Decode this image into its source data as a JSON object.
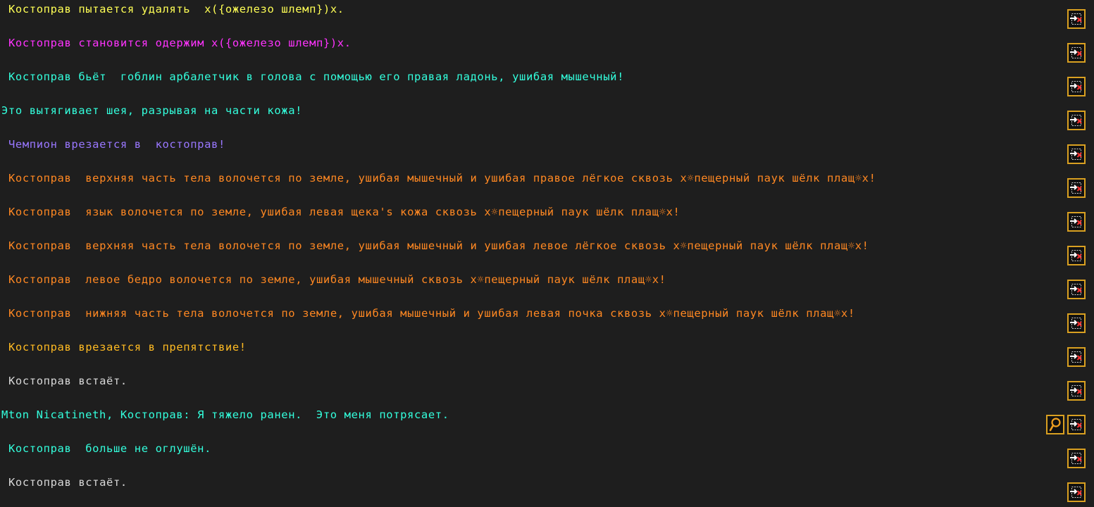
{
  "colors": {
    "yellow": "#ffff55",
    "magenta": "#ff33ff",
    "cyan": "#33ffdd",
    "violet": "#9977ff",
    "orange": "#ff8822",
    "amber": "#ffbb22",
    "white": "#d8d8d8",
    "button_border": "#d9a021"
  },
  "messages": [
    {
      "text": "Костоправ пытается удалять  x({ожелезо шлемп})x.",
      "color": "yellow",
      "indent": true,
      "zoom": false
    },
    {
      "text": "Костоправ становится одержим x({ожелезо шлемп})x.",
      "color": "magenta",
      "indent": true,
      "zoom": false
    },
    {
      "text": "Костоправ бьёт  гоблин арбалетчик в голова с помощью его правая ладонь, ушибая мышечный!",
      "color": "cyan",
      "indent": true,
      "zoom": false
    },
    {
      "text": "Это вытягивает шея, разрывая на части кожа!",
      "color": "cyan",
      "indent": false,
      "zoom": false
    },
    {
      "text": "Чемпион врезается в  костоправ!",
      "color": "violet",
      "indent": true,
      "zoom": false
    },
    {
      "text": "Костоправ  верхняя часть тела волочется по земле, ушибая мышечный и ушибая правое лёгкое сквозь x☼пещерный паук шёлк плащ☼x!",
      "color": "orange",
      "indent": true,
      "zoom": false
    },
    {
      "text": "Костоправ  язык волочется по земле, ушибая левая щека's кожа сквозь x☼пещерный паук шёлк плащ☼x!",
      "color": "orange",
      "indent": true,
      "zoom": false
    },
    {
      "text": "Костоправ  верхняя часть тела волочется по земле, ушибая мышечный и ушибая левое лёгкое сквозь x☼пещерный паук шёлк плащ☼x!",
      "color": "orange",
      "indent": true,
      "zoom": false
    },
    {
      "text": "Костоправ  левое бедро волочется по земле, ушибая мышечный сквозь x☼пещерный паук шёлк плащ☼x!",
      "color": "orange",
      "indent": true,
      "zoom": false
    },
    {
      "text": "Костоправ  нижняя часть тела волочется по земле, ушибая мышечный и ушибая левая почка сквозь x☼пещерный паук шёлк плащ☼x!",
      "color": "orange",
      "indent": true,
      "zoom": false
    },
    {
      "text": "Костоправ врезается в препятствие!",
      "color": "amber",
      "indent": true,
      "zoom": false
    },
    {
      "text": "Костоправ встаёт.",
      "color": "white",
      "indent": true,
      "zoom": false
    },
    {
      "text": "Mton Nicatineth, Костоправ: Я тяжело ранен.  Это меня потрясает.",
      "color": "cyan",
      "indent": false,
      "zoom": true
    },
    {
      "text": "Костоправ  больше не оглушён.",
      "color": "cyan",
      "indent": true,
      "zoom": false
    },
    {
      "text": "Костоправ встаёт.",
      "color": "white",
      "indent": true,
      "zoom": false
    }
  ],
  "icons": {
    "delete": "delete-report-icon",
    "zoom": "zoom-to-location-icon"
  }
}
